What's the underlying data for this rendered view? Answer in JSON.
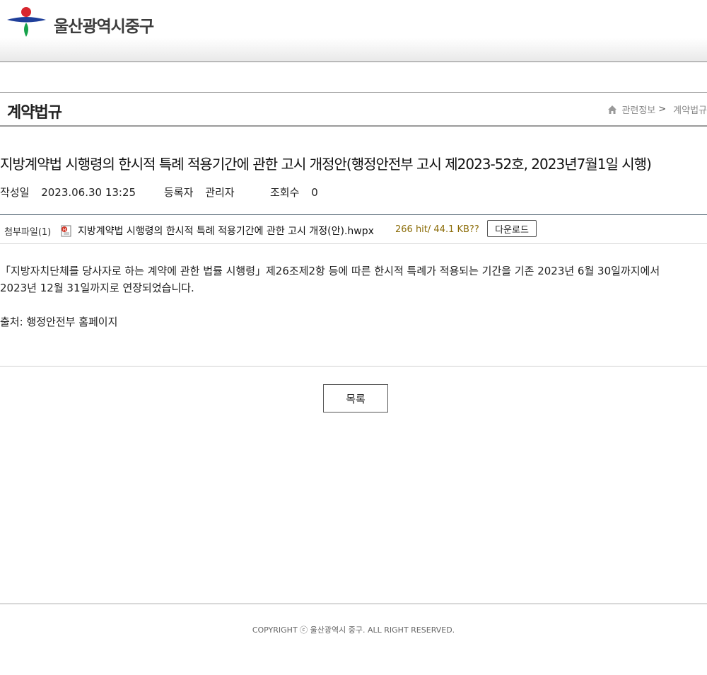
{
  "header": {
    "logo_text": "울산광역시중구",
    "logo_colors": {
      "red": "#d7262e",
      "blue": "#1f3f9a",
      "green": "#16a24a"
    }
  },
  "title_bar": {
    "page_title": "계약법규",
    "breadcrumb": {
      "item1": "관련정보",
      "separator": ">",
      "item2": "계약법규"
    }
  },
  "post": {
    "title": "지방계약법 시행령의 한시적 특례 적용기간에 관한 고시 개정안(행정안전부 고시 제2023-52호, 2023년7월1일 시행)",
    "meta": {
      "date_label": "작성일",
      "date_value": "2023.06.30 13:25",
      "author_label": "등록자",
      "author_value": "관리자",
      "views_label": "조회수",
      "views_value": "0"
    },
    "attachment": {
      "label": "첨부파일(1)",
      "file_name": "지방계약법 시행령의 한시적 특례 적용기간에 관한 고시 개정(안).hwpx",
      "file_info": "266 hit/ 44.1 KB??",
      "download_label": "다운로드",
      "icon": "hwp-file-icon"
    },
    "body": {
      "para1_line1": "「지방자치단체를 당사자로 하는 계약에 관한 법률 시행령」제26조제2항 등에 따른 한시적 특례가 적용되는 기간을 기존 2023년 6월 30일까지에서",
      "para1_line2": "2023년 12월 31일까지로 연장되었습니다.",
      "source": "출처: 행정안전부 홈페이지"
    }
  },
  "list_button_label": "목록",
  "footer": {
    "copyright": "COPYRIGHT ⓒ 울산광역시 중구. ALL RIGHT RESERVED."
  }
}
